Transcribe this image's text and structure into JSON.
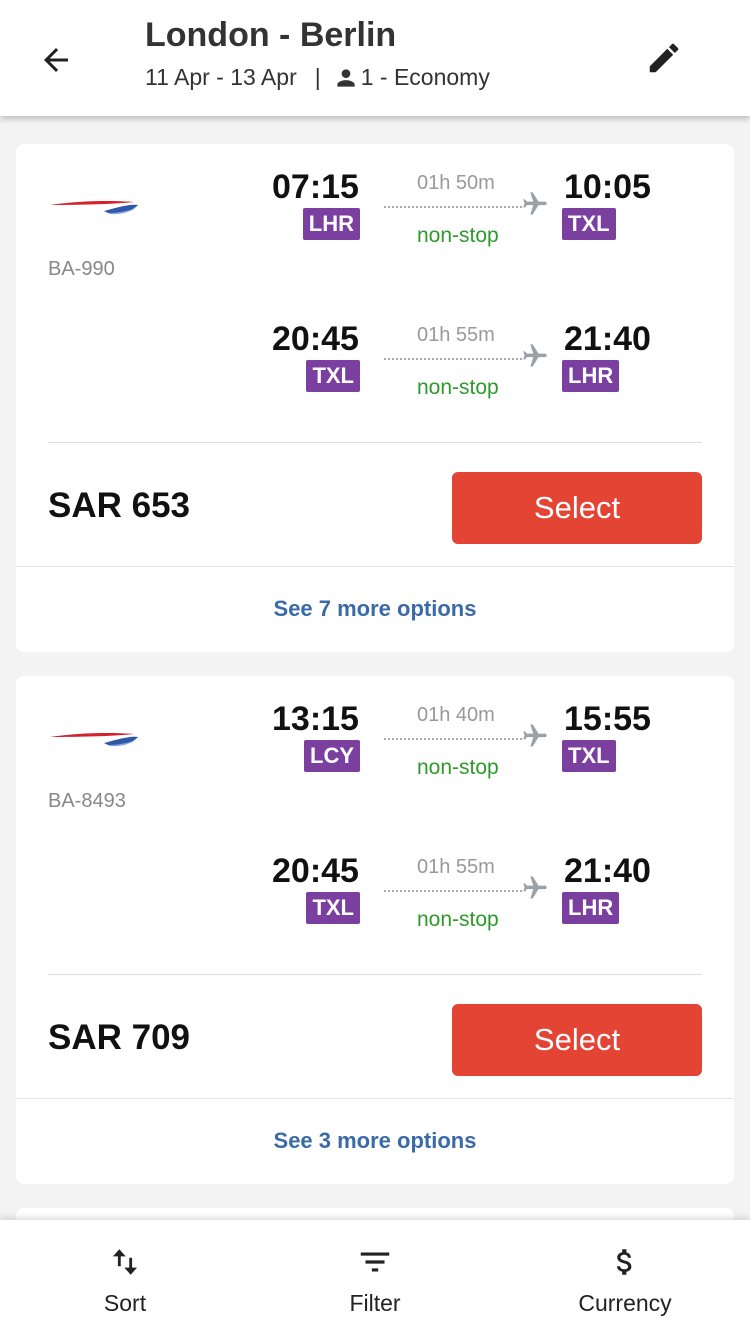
{
  "header": {
    "title": "London - Berlin",
    "dates": "11 Apr - 13 Apr",
    "separator": "|",
    "passengers": "1 - Economy"
  },
  "results": [
    {
      "flight_no": "BA-990",
      "legs": [
        {
          "dep_time": "07:15",
          "dep_code": "LHR",
          "duration": "01h 50m",
          "stops": "non-stop",
          "arr_time": "10:05",
          "arr_code": "TXL"
        },
        {
          "dep_time": "20:45",
          "dep_code": "TXL",
          "duration": "01h 55m",
          "stops": "non-stop",
          "arr_time": "21:40",
          "arr_code": "LHR"
        }
      ],
      "price": "SAR 653",
      "select_label": "Select",
      "more_options": "See 7 more options"
    },
    {
      "flight_no": "BA-8493",
      "legs": [
        {
          "dep_time": "13:15",
          "dep_code": "LCY",
          "duration": "01h 40m",
          "stops": "non-stop",
          "arr_time": "15:55",
          "arr_code": "TXL"
        },
        {
          "dep_time": "20:45",
          "dep_code": "TXL",
          "duration": "01h 55m",
          "stops": "non-stop",
          "arr_time": "21:40",
          "arr_code": "LHR"
        }
      ],
      "price": "SAR 709",
      "select_label": "Select",
      "more_options": "See 3 more options"
    }
  ],
  "bottom_bar": {
    "sort_label": "Sort",
    "filter_label": "Filter",
    "currency_label": "Currency"
  },
  "icons": {
    "back": "arrow-left-icon",
    "edit": "pencil-icon",
    "person": "person-icon",
    "plane": "airplane-icon",
    "sort": "sort-arrows-icon",
    "filter": "filter-lines-icon",
    "currency": "dollar-icon"
  },
  "colors": {
    "airport_badge": "#7b3fa0",
    "non_stop": "#2e9a2a",
    "select_button": "#e44434",
    "link": "#3a6aa8"
  }
}
